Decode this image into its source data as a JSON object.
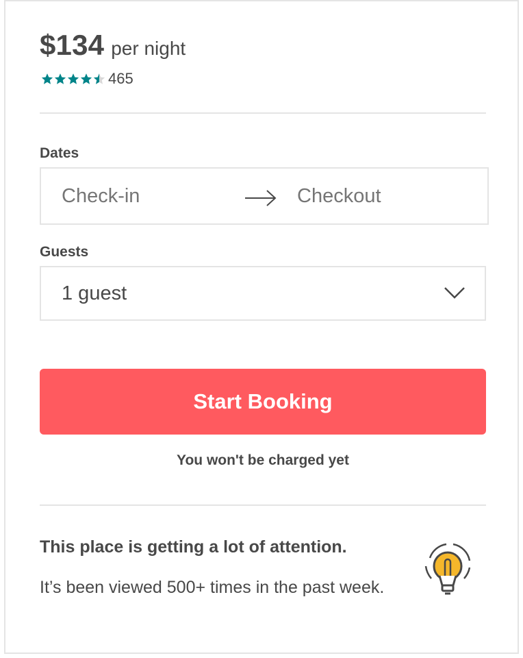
{
  "listing": {
    "price": "$134",
    "price_unit": "per night",
    "rating": 4.5,
    "rating_max": 5,
    "review_count": "465"
  },
  "dates": {
    "label": "Dates",
    "checkin_placeholder": "Check-in",
    "checkout_placeholder": "Checkout",
    "arrow_icon": "arrow-right-icon"
  },
  "guests": {
    "label": "Guests",
    "selected": "1 guest",
    "dropdown_icon": "chevron-down-icon"
  },
  "booking": {
    "button_label": "Start Booking",
    "note": "You won't be charged yet"
  },
  "attention": {
    "title": "This place is getting a lot of attention.",
    "body": "It’s been viewed 500+ times in the past week.",
    "icon": "lightbulb-icon"
  },
  "colors": {
    "accent": "#ff5a5f",
    "star": "#008489",
    "text": "#484848",
    "muted": "#757575",
    "border": "#e4e4e4",
    "bulb": "#f5b72b"
  }
}
